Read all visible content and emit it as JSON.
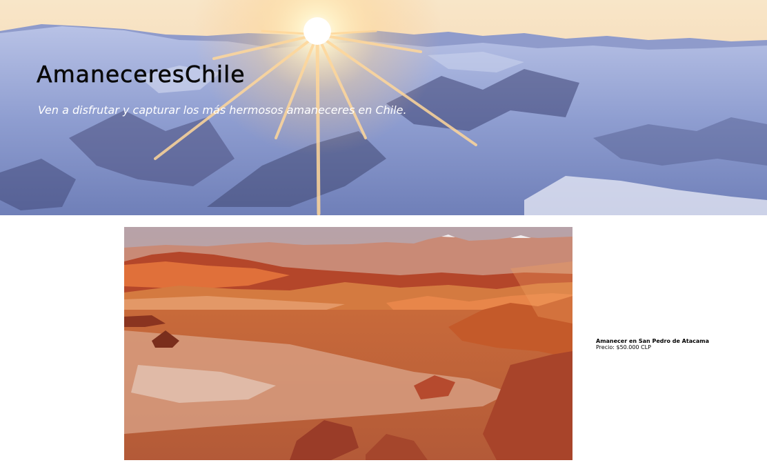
{
  "header": {
    "title": "AmaneceresChile",
    "subtitle": "Ven a disfrutar y capturar los más hermosos amaneceres en Chile."
  },
  "product": {
    "name": "Amanecer en San Pedro de Atacama",
    "price": "Precio: $50.000 CLP"
  },
  "colors": {
    "sky_top": "#f7d9b0",
    "snow": "#9fb0d8",
    "shadow": "#3a3f6a",
    "sun": "#fff6dc",
    "desert": "#d2692e",
    "desert_dark": "#7a2e1c"
  }
}
